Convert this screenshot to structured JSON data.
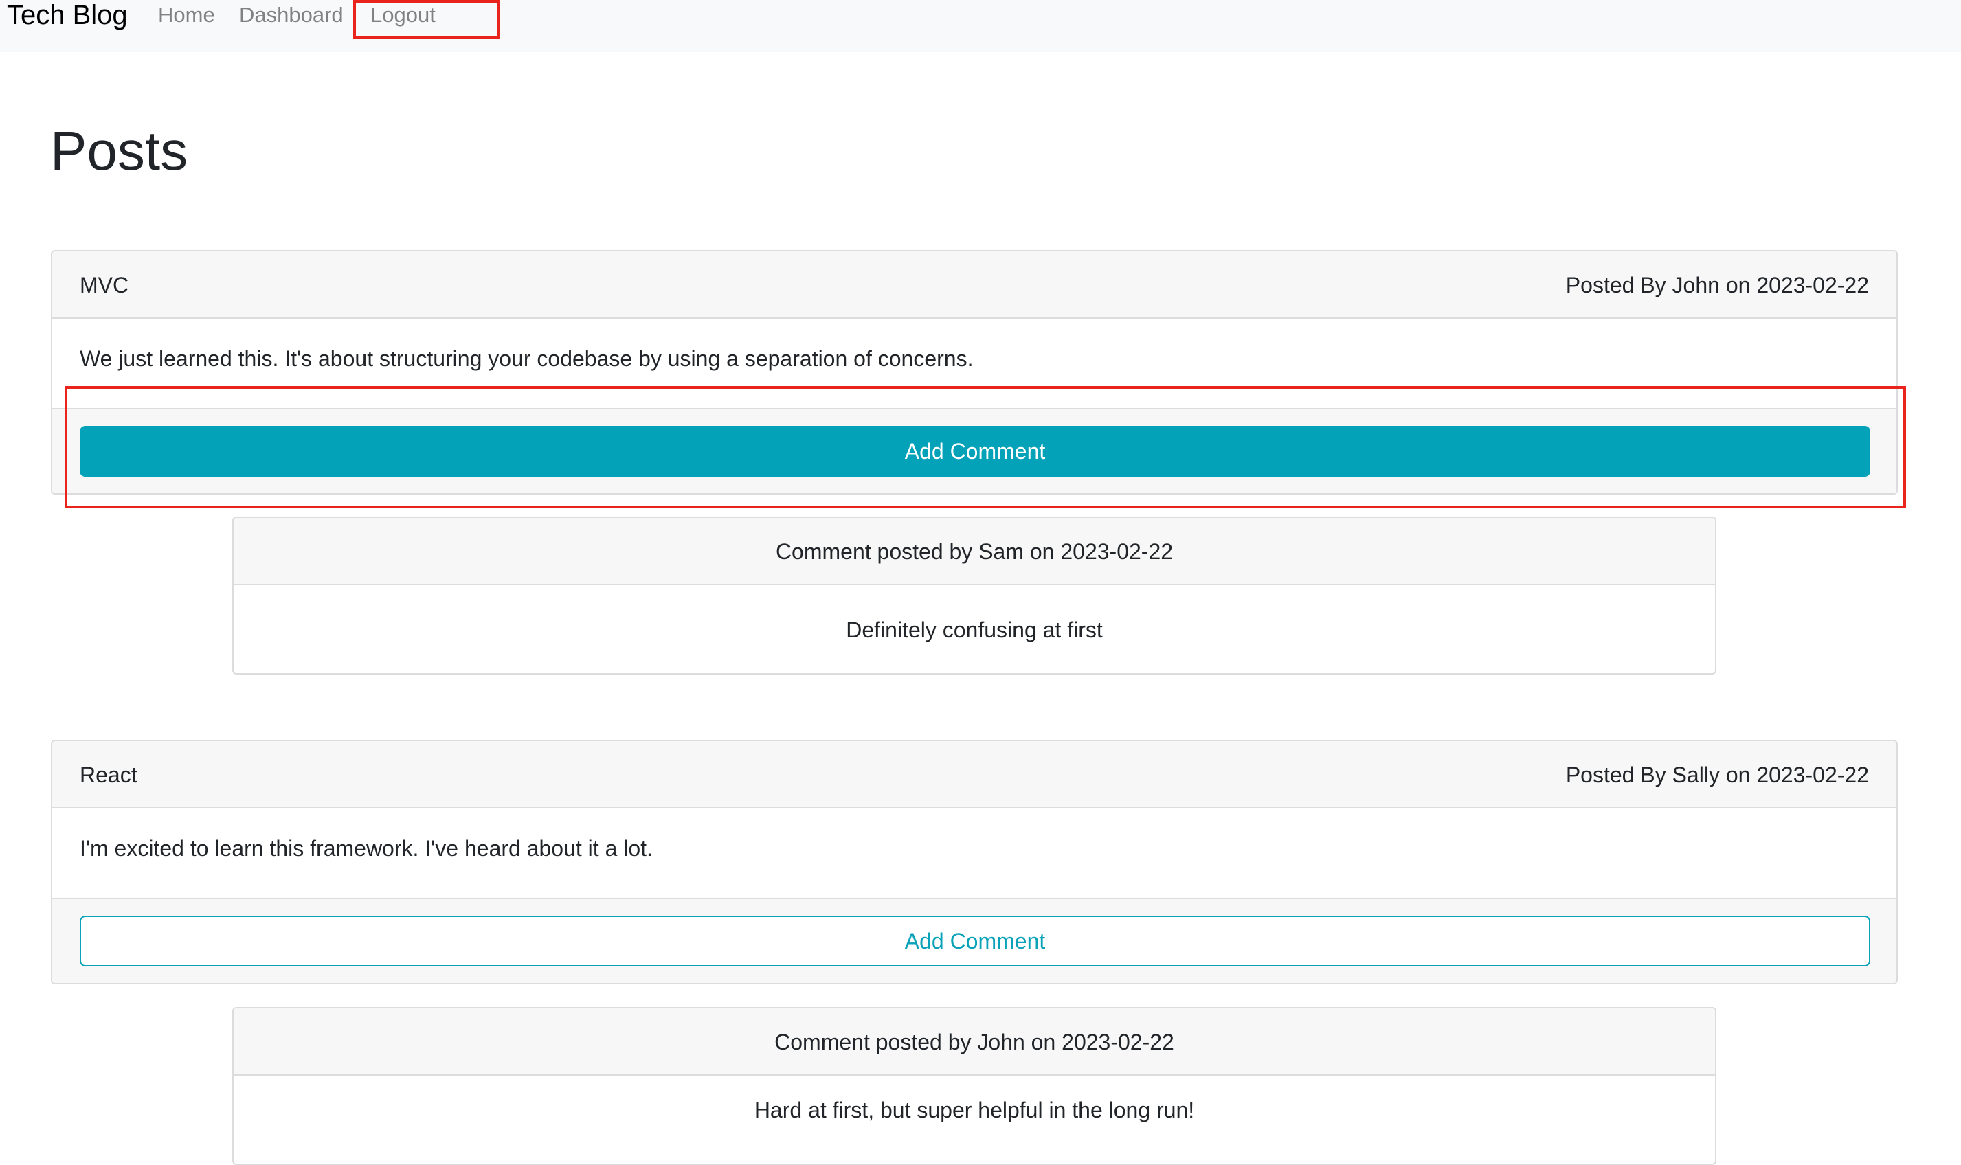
{
  "nav": {
    "brand": "Tech Blog",
    "links": [
      "Home",
      "Dashboard",
      "Logout"
    ]
  },
  "page": {
    "title": "Posts"
  },
  "posts": [
    {
      "title": "MVC",
      "meta": "Posted By John on 2023-02-22",
      "content": "We just learned this. It's about structuring your codebase by using a separation of concerns.",
      "button": "Add Comment",
      "comments": [
        {
          "header": "Comment posted by Sam on 2023-02-22",
          "text": "Definitely confusing at first"
        }
      ]
    },
    {
      "title": "React",
      "meta": "Posted By Sally on 2023-02-22",
      "content": "I'm excited to learn this framework. I've heard about it a lot.",
      "button": "Add Comment",
      "comments": [
        {
          "header": "Comment posted by John on 2023-02-22",
          "text": "Hard at first, but super helpful in the long run!"
        }
      ]
    }
  ],
  "colors": {
    "accent": "#03a2b8",
    "highlight": "#e8241c",
    "navbar_bg": "#f8f9fa"
  }
}
